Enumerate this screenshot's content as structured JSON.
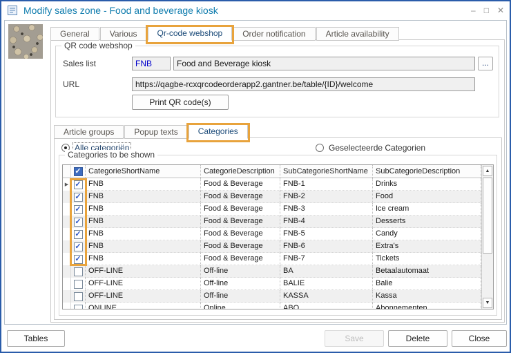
{
  "window": {
    "title": "Modify sales zone - Food and beverage kiosk",
    "controls": {
      "minimize": "–",
      "maximize": "□",
      "close": "✕"
    }
  },
  "main_tabs": {
    "items": [
      {
        "label": "General",
        "selected": false,
        "annotated": false
      },
      {
        "label": "Various",
        "selected": false,
        "annotated": false
      },
      {
        "label": "Qr-code webshop",
        "selected": true,
        "annotated": true
      },
      {
        "label": "Order notification",
        "selected": false,
        "annotated": false
      },
      {
        "label": "Article availability",
        "selected": false,
        "annotated": false
      }
    ]
  },
  "qr_webshop": {
    "group_label": "QR code webshop",
    "sales_list": {
      "label": "Sales list",
      "code": "FNB",
      "name": "Food and Beverage kiosk",
      "browse_label": "..."
    },
    "url": {
      "label": "URL",
      "value": "https://qagbe-rcxqrcodeorderapp2.gantner.be/table/{ID}/welcome"
    },
    "print_button_label": "Print QR code(s)"
  },
  "sub_tabs": {
    "items": [
      {
        "label": "Article groups",
        "selected": false,
        "annotated": false
      },
      {
        "label": "Popup texts",
        "selected": false,
        "annotated": false
      },
      {
        "label": "Categories",
        "selected": true,
        "annotated": true
      }
    ]
  },
  "categories_tab": {
    "radio_all": {
      "label": "Alle categoriën",
      "selected": true
    },
    "radio_selected": {
      "label": "Geselecteerde Categorien",
      "selected": false
    },
    "group_label": "Categories to be shown",
    "table": {
      "select_all_checked": true,
      "columns": [
        "CategorieShortName",
        "CategorieDescription",
        "SubCategorieShortName",
        "SubCategorieDescription"
      ],
      "rows": [
        {
          "checked": true,
          "cells": [
            "FNB",
            "Food & Beverage",
            "FNB-1",
            "Drinks"
          ]
        },
        {
          "checked": true,
          "cells": [
            "FNB",
            "Food & Beverage",
            "FNB-2",
            "Food"
          ]
        },
        {
          "checked": true,
          "cells": [
            "FNB",
            "Food & Beverage",
            "FNB-3",
            "Ice cream"
          ]
        },
        {
          "checked": true,
          "cells": [
            "FNB",
            "Food & Beverage",
            "FNB-4",
            "Desserts"
          ]
        },
        {
          "checked": true,
          "cells": [
            "FNB",
            "Food & Beverage",
            "FNB-5",
            "Candy"
          ]
        },
        {
          "checked": true,
          "cells": [
            "FNB",
            "Food & Beverage",
            "FNB-6",
            "Extra's"
          ]
        },
        {
          "checked": true,
          "cells": [
            "FNB",
            "Food & Beverage",
            "FNB-7",
            "Tickets"
          ]
        },
        {
          "checked": false,
          "cells": [
            "OFF-LINE",
            "Off-line",
            "BA",
            "Betaalautomaat"
          ]
        },
        {
          "checked": false,
          "cells": [
            "OFF-LINE",
            "Off-line",
            "BALIE",
            "Balie"
          ]
        },
        {
          "checked": false,
          "cells": [
            "OFF-LINE",
            "Off-line",
            "KASSA",
            "Kassa"
          ]
        },
        {
          "checked": false,
          "cells": [
            "ONLINE",
            "Online",
            "ABO",
            "Abonnementen"
          ]
        }
      ]
    }
  },
  "footer": {
    "tables_label": "Tables",
    "save_label": "Save",
    "save_enabled": false,
    "delete_label": "Delete",
    "close_label": "Close"
  },
  "icons": {
    "row_selector": "▶",
    "scroll_up": "▲",
    "scroll_down": "▼"
  },
  "colors": {
    "annotation_orange": "#e8a33c",
    "tab_accent_blue": "#2196f3",
    "title_text": "#0d7bad",
    "window_border": "#2a5caa",
    "code_text_blue": "#0000cc",
    "check_blue": "#2e57c8"
  }
}
